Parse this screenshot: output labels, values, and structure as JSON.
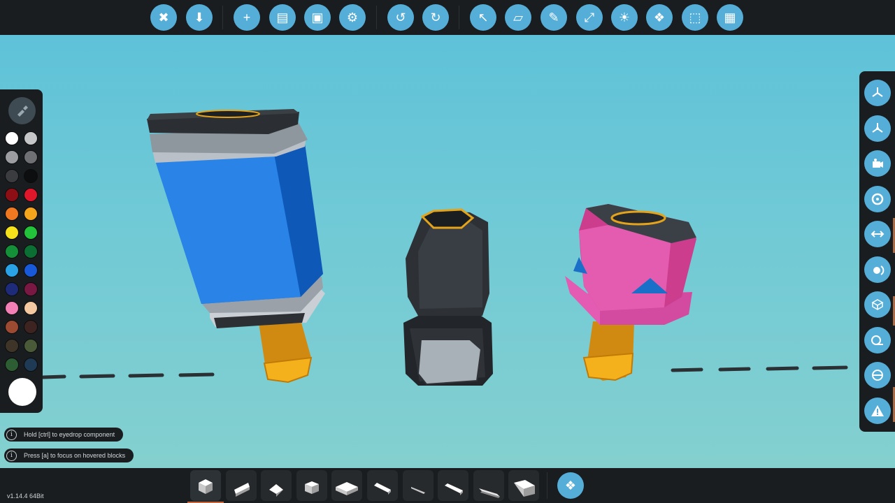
{
  "toolbar": {
    "buttons": [
      {
        "name": "close-icon",
        "glyph": "✖"
      },
      {
        "name": "save-down-icon",
        "glyph": "⬇"
      },
      {
        "name": "add-icon",
        "glyph": "+"
      },
      {
        "name": "folder-icon",
        "glyph": "▤"
      },
      {
        "name": "disk-icon",
        "glyph": "▣"
      },
      {
        "name": "steam-icon",
        "glyph": "⚙"
      },
      {
        "name": "undo-icon",
        "glyph": "↺"
      },
      {
        "name": "redo-icon",
        "glyph": "↻"
      },
      {
        "name": "select-arrow-icon",
        "glyph": "↖"
      },
      {
        "name": "eraser-icon",
        "glyph": "▱"
      },
      {
        "name": "paint-brush-icon",
        "glyph": "✎"
      },
      {
        "name": "transform-axes-icon",
        "glyph": "⤢"
      },
      {
        "name": "light-bulb-icon",
        "glyph": "☀"
      },
      {
        "name": "blocks-cluster-icon",
        "glyph": "❖"
      },
      {
        "name": "selection-box-icon",
        "glyph": "⬚"
      },
      {
        "name": "microcontroller-icon",
        "glyph": "▦"
      }
    ]
  },
  "palette": {
    "colors": [
      [
        "#ffffff",
        "#c4c6c8"
      ],
      [
        "#9b9da0",
        "#6e7073"
      ],
      [
        "#3a3c3f",
        "#0d0e0f"
      ],
      [
        "#8b0f14",
        "#e0162a"
      ],
      [
        "#f07820",
        "#f5a51b"
      ],
      [
        "#f5e21b",
        "#22c33a"
      ],
      [
        "#149138",
        "#0b6e33"
      ],
      [
        "#29a3e6",
        "#1759d9"
      ],
      [
        "#1e2b78",
        "#7a1844"
      ],
      [
        "#f27fb5",
        "#f4c9a2"
      ],
      [
        "#9c4a32",
        "#3d2420"
      ],
      [
        "#3f3428",
        "#4a5a38"
      ],
      [
        "#2d5e33",
        "#1e3a55"
      ]
    ],
    "selected_color": "#ffffff"
  },
  "right_tools": [
    {
      "name": "orientation-icon"
    },
    {
      "name": "orientation-alt-icon"
    },
    {
      "name": "camera-icon"
    },
    {
      "name": "target-icon"
    },
    {
      "name": "logic-flow-icon"
    },
    {
      "name": "fluid-icon"
    },
    {
      "name": "cube-outline-icon"
    },
    {
      "name": "tape-measure-icon"
    },
    {
      "name": "ballast-icon"
    },
    {
      "name": "warning-icon"
    }
  ],
  "hints": [
    "Hold [ctrl] to eyedrop component",
    "Press [a] to focus on hovered blocks"
  ],
  "hint_icon_glyph": "i",
  "version": "v1.14.4 64Bit",
  "bottom_blocks": [
    {
      "name": "block-cube"
    },
    {
      "name": "block-wedge"
    },
    {
      "name": "block-pyramid"
    },
    {
      "name": "block-half-cube"
    },
    {
      "name": "block-slab"
    },
    {
      "name": "block-thin-wedge"
    },
    {
      "name": "block-sliver"
    },
    {
      "name": "block-long-wedge"
    },
    {
      "name": "block-flat-wedge"
    },
    {
      "name": "block-ramp"
    }
  ],
  "accent_color": "#55aed8",
  "panel_color": "#1a1d1f"
}
